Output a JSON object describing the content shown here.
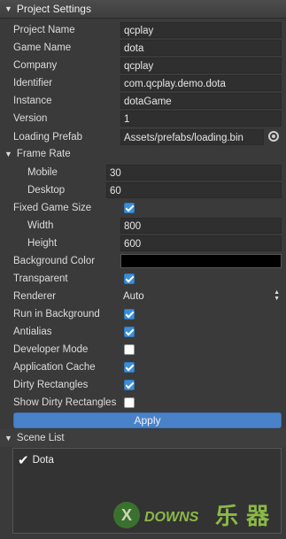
{
  "header": {
    "title": "Project Settings"
  },
  "project": {
    "project_name": {
      "label": "Project Name",
      "value": "qcplay"
    },
    "game_name": {
      "label": "Game Name",
      "value": "dota"
    },
    "company": {
      "label": "Company",
      "value": "qcplay"
    },
    "identifier": {
      "label": "Identifier",
      "value": "com.qcplay.demo.dota"
    },
    "instance": {
      "label": "Instance",
      "value": "dotaGame"
    },
    "version": {
      "label": "Version",
      "value": "1"
    },
    "loading_prefab": {
      "label": "Loading Prefab",
      "value": "Assets/prefabs/loading.bin"
    }
  },
  "frame_rate": {
    "label": "Frame Rate",
    "mobile": {
      "label": "Mobile",
      "value": "30"
    },
    "desktop": {
      "label": "Desktop",
      "value": "60"
    }
  },
  "fixed_game_size": {
    "label": "Fixed Game Size",
    "checked": true,
    "width": {
      "label": "Width",
      "value": "800"
    },
    "height": {
      "label": "Height",
      "value": "600"
    }
  },
  "background_color": {
    "label": "Background Color",
    "color": "#000000"
  },
  "transparent": {
    "label": "Transparent",
    "checked": true
  },
  "renderer": {
    "label": "Renderer",
    "value": "Auto"
  },
  "run_in_background": {
    "label": "Run in Background",
    "checked": true
  },
  "antialias": {
    "label": "Antialias",
    "checked": true
  },
  "developer_mode": {
    "label": "Developer Mode",
    "checked": false
  },
  "application_cache": {
    "label": "Application Cache",
    "checked": true
  },
  "dirty_rectangles": {
    "label": "Dirty Rectangles",
    "checked": true
  },
  "show_dirty_rectangles": {
    "label": "Show Dirty Rectangles",
    "checked": false
  },
  "apply_button": {
    "label": "Apply"
  },
  "scene_list": {
    "title": "Scene List",
    "items": [
      {
        "name": "Dota",
        "checked": true
      }
    ]
  },
  "watermark": {
    "text_left": "DOWNS",
    "text_right": "乐 器"
  },
  "colors": {
    "accent": "#3b8fd9",
    "apply": "#4a82c9",
    "panel": "#3a3a3a",
    "field": "#2f2f2f"
  }
}
